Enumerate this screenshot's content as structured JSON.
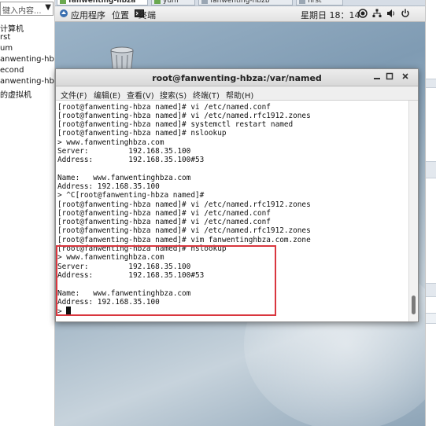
{
  "library": {
    "search_placeholder": "键入内容...",
    "items": [
      "计算机",
      "rst",
      "um",
      "anwenting-hbz",
      "econd",
      "anwenting-hbz",
      "的虚拟机"
    ]
  },
  "vm_tabs": [
    "fanwenting-hbza",
    "yum",
    "fanwenting-hbzb",
    "first"
  ],
  "gnome_panel": {
    "applications": "应用程序",
    "places": "位置",
    "terminal": "终端",
    "clock": "星期日 18：14"
  },
  "terminal": {
    "title": "root@fanwenting-hbza:/var/named",
    "menu": [
      "文件(F)",
      "编辑(E)",
      "查看(V)",
      "搜索(S)",
      "终端(T)",
      "帮助(H)"
    ],
    "lines": [
      "[root@fanwenting-hbza named]# vi /etc/named.conf",
      "[root@fanwenting-hbza named]# vi /etc/named.rfc1912.zones",
      "[root@fanwenting-hbza named]# systemctl restart named",
      "[root@fanwenting-hbza named]# nslookup",
      "> www.fanwentinghbza.com",
      "Server:         192.168.35.100",
      "Address:        192.168.35.100#53",
      "",
      "Name:   www.fanwentinghbza.com",
      "Address: 192.168.35.100",
      "> ^C[root@fanwenting-hbza named]#",
      "[root@fanwenting-hbza named]# vi /etc/named.rfc1912.zones",
      "[root@fanwenting-hbza named]# vi /etc/named.conf",
      "[root@fanwenting-hbza named]# vi /etc/named.conf",
      "[root@fanwenting-hbza named]# vi /etc/named.rfc1912.zones",
      "[root@fanwenting-hbza named]# vim fanwentinghbza.com.zone",
      "[root@fanwenting-hbza named]# nslookup",
      "> www.fanwentinghbza.com",
      "Server:         192.168.35.100",
      "Address:        192.168.35.100#53",
      "",
      "Name:   www.fanwentinghbza.com",
      "Address: 192.168.35.100",
      "> "
    ]
  },
  "colors": {
    "highlight": "#d9363e",
    "panel": "#e2e2e2",
    "desktop": "#8da4b7"
  },
  "icons": [
    "trash-icon",
    "terminal-icon",
    "record-icon",
    "network-icon",
    "volume-icon",
    "power-icon",
    "minimize-icon",
    "maximize-icon",
    "close-icon",
    "search-dropdown-icon"
  ]
}
